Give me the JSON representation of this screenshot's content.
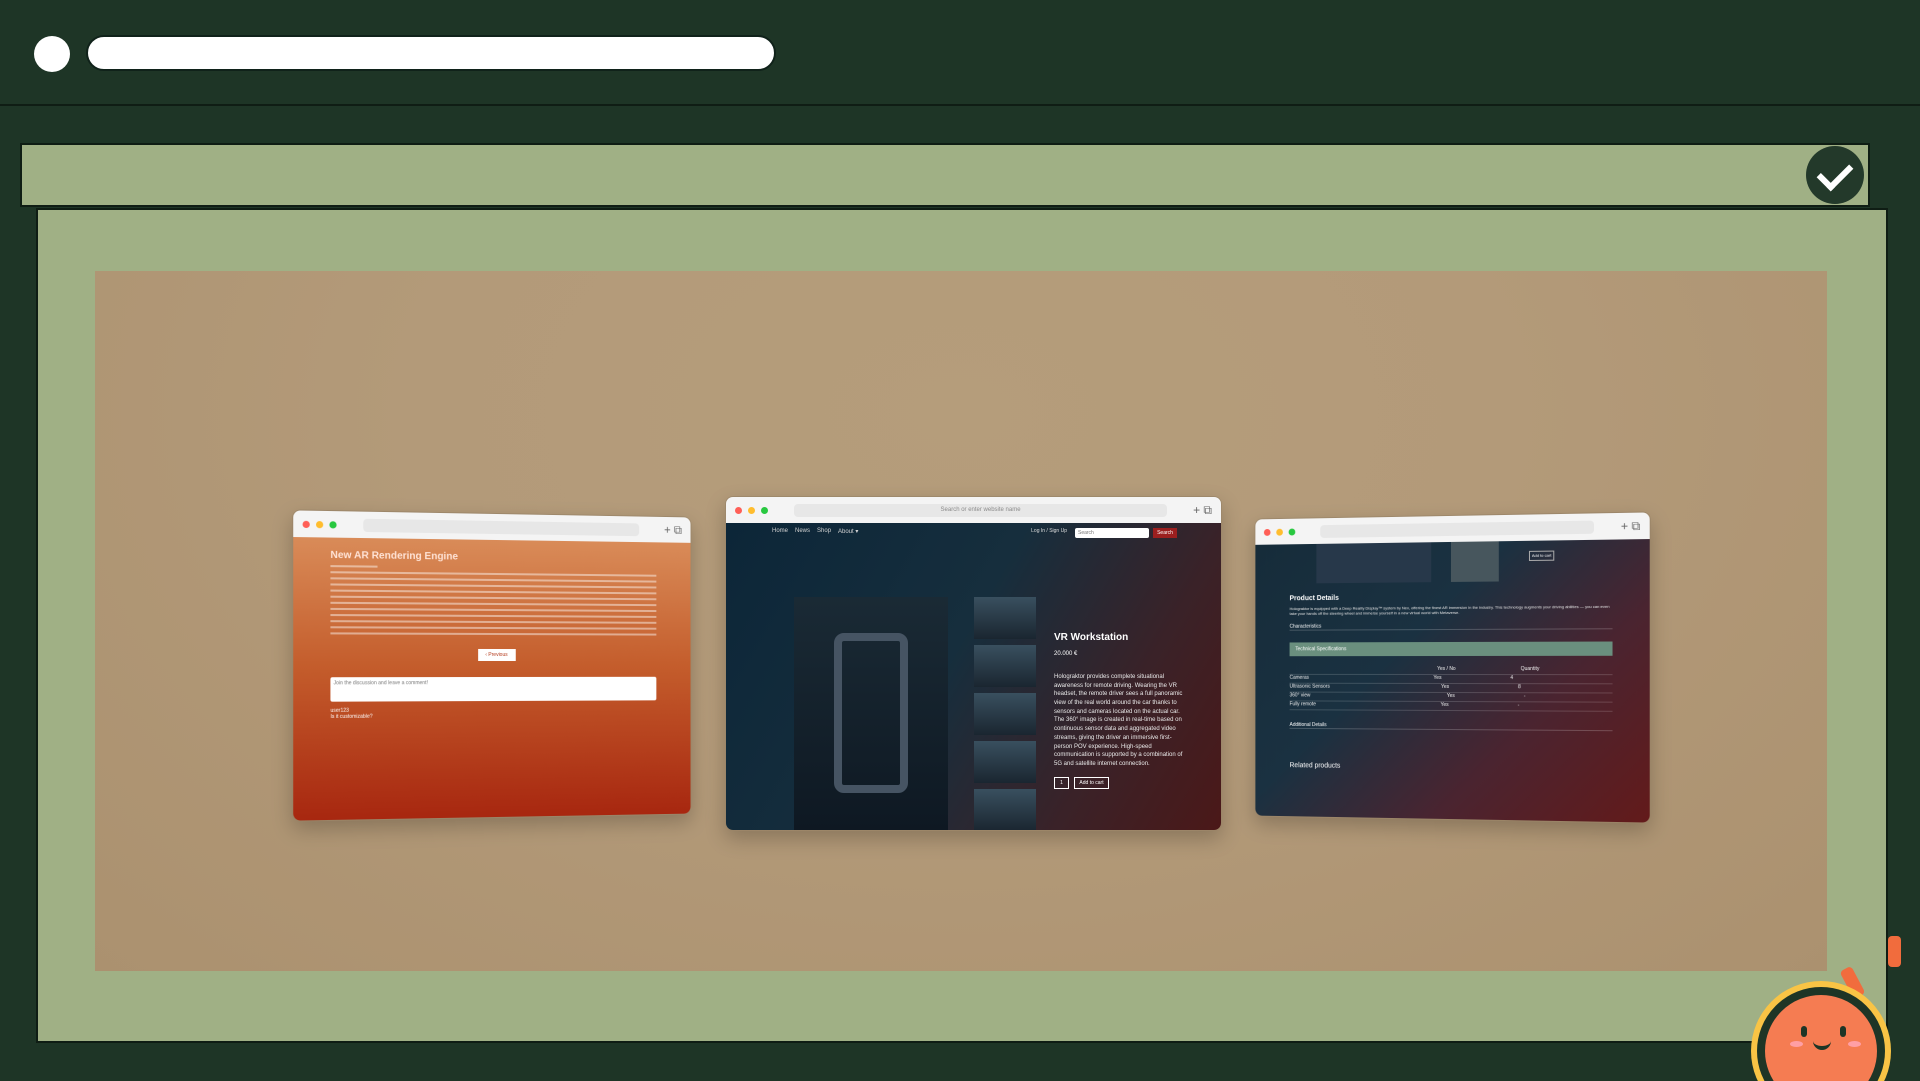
{
  "top": {
    "url": ""
  },
  "windows": [
    {
      "name": "article",
      "title": "New AR Rendering Engine",
      "button": "‹ Previous",
      "comment_placeholder": "Join the discussion and leave a comment!",
      "author": "user123",
      "reply": "Is it customizable?"
    },
    {
      "name": "product",
      "address": "Search or enter website name",
      "nav": [
        "Home",
        "News",
        "Shop",
        "About ▾"
      ],
      "login": "Log In / Sign Up",
      "search_placeholder": "Search",
      "search_button": "Search",
      "title": "VR Workstation",
      "price": "20.000 €",
      "description": "Holograktor provides complete situational awareness for remote driving. Wearing the VR headset, the remote driver sees a full panoramic view of the real world around the car thanks to sensors and cameras located on the actual car. The 360° image is created in real-time based on continuous sensor data and aggregated video streams, giving the driver an immersive first-person POV experience. High-speed communication is supported by a combination of 5G and satellite internet connection.",
      "qty": "1",
      "add": "Add to cart"
    },
    {
      "name": "details",
      "heading": "Product Details",
      "summary": "Holograktor is equipped with a Deep Reality Display™ system by Nex, offering the finest AR immersion in the industry. This technology augments your driving abilities — you can even take your hands off the steering wheel and immerse yourself in a new virtual world with Metaverse.",
      "characteristics": "Characteristics",
      "technical": "Technical Specifications",
      "cols": [
        "Yes / No",
        "Quantity"
      ],
      "rows": [
        [
          "Cameras",
          "Yes",
          "4"
        ],
        [
          "Ultrasonic Sensors",
          "Yes",
          "8"
        ],
        [
          "360° view",
          "Yes",
          "-"
        ],
        [
          "Fully remote",
          "Yes",
          "-"
        ]
      ],
      "additional": "Additional Details",
      "related": "Related products",
      "small_button": "Add to cart"
    }
  ]
}
